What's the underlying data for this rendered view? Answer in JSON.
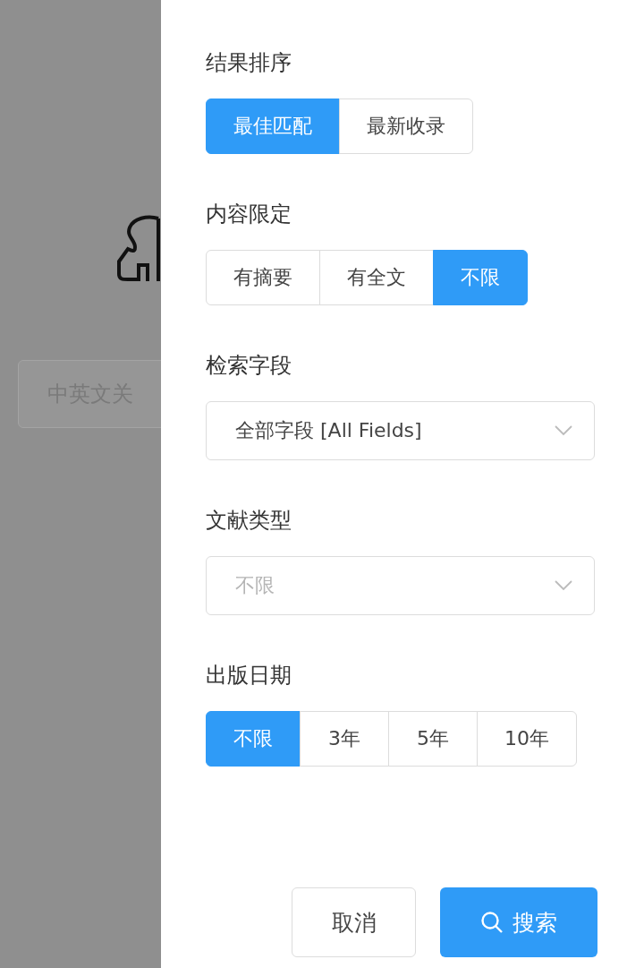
{
  "backdrop": {
    "search": {
      "placeholder": "中英文关"
    }
  },
  "sections": [
    {
      "kind": "segments",
      "title": "结果排序",
      "options": [
        {
          "label": "最佳匹配",
          "selected": true
        },
        {
          "label": "最新收录",
          "selected": false
        }
      ]
    },
    {
      "kind": "segments",
      "title": "内容限定",
      "options": [
        {
          "label": "有摘要",
          "selected": false
        },
        {
          "label": "有全文",
          "selected": false
        },
        {
          "label": "不限",
          "selected": true
        }
      ]
    },
    {
      "kind": "select",
      "title": "检索字段",
      "value": "全部字段 [All Fields]"
    },
    {
      "kind": "select",
      "title": "文献类型",
      "placeholder": "不限"
    },
    {
      "kind": "segments",
      "title": "出版日期",
      "options": [
        {
          "label": "不限",
          "selected": true
        },
        {
          "label": "3年",
          "selected": false
        },
        {
          "label": "5年",
          "selected": false
        },
        {
          "label": "10年",
          "selected": false
        }
      ]
    }
  ],
  "buttons": [
    {
      "kind": "cancel",
      "label": "取消"
    },
    {
      "kind": "search",
      "label": "搜索"
    }
  ]
}
